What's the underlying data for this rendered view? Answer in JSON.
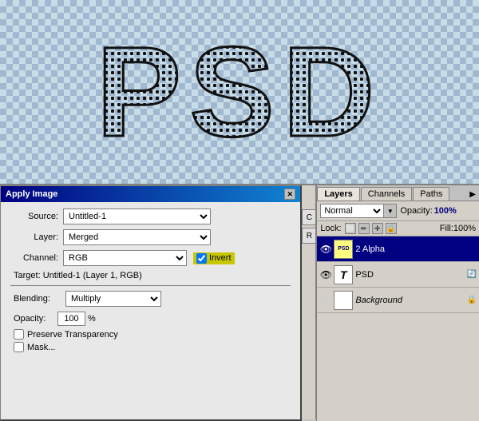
{
  "canvas": {
    "text": "PSD"
  },
  "dialog": {
    "title": "Apply Image",
    "source_label": "Source:",
    "source_value": "Untitled-1",
    "layer_label": "Layer:",
    "layer_value": "Merged",
    "channel_label": "Channel:",
    "channel_value": "RGB",
    "invert_label": "Invert",
    "invert_checked": true,
    "target_label": "Target:",
    "target_value": "Untitled-1 (Layer 1, RGB)",
    "blending_label": "Blending:",
    "blending_value": "Multiply",
    "opacity_label": "Opacity:",
    "opacity_value": "100",
    "opacity_unit": "%",
    "preserve_label": "Preserve Transparency",
    "mask_label": "Mask..."
  },
  "layers_panel": {
    "tabs": [
      {
        "label": "Layers",
        "active": true
      },
      {
        "label": "Channels",
        "active": false
      },
      {
        "label": "Paths",
        "active": false
      }
    ],
    "blend_mode": "Normal",
    "opacity_label": "Opacity:",
    "opacity_value": "100%",
    "lock_label": "Lock:",
    "fill_label": "Fill:",
    "fill_value": "100%",
    "layers": [
      {
        "name": "2 Alpha",
        "type": "psd",
        "thumb_label": "PSD",
        "visible": true,
        "active": true
      },
      {
        "name": "PSD",
        "type": "text",
        "thumb_label": "T",
        "visible": true,
        "active": false,
        "has_fx": true
      },
      {
        "name": "Background",
        "type": "bg",
        "thumb_label": "",
        "visible": false,
        "active": false,
        "locked": true
      }
    ],
    "ok_label": "C",
    "re_label": "Re"
  }
}
